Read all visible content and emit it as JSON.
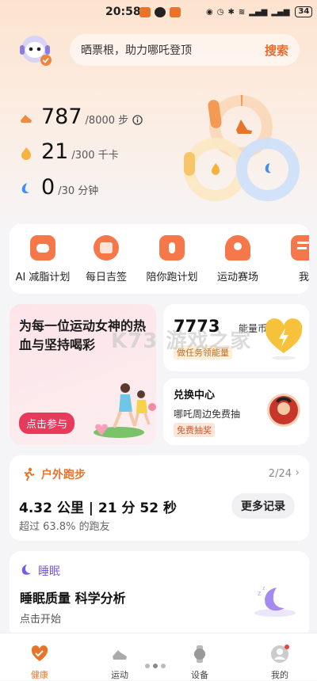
{
  "status": {
    "time": "20:58",
    "battery": "34"
  },
  "search": {
    "placeholder": "晒票根，助力哪吒登顶",
    "button": "搜索"
  },
  "metrics": [
    {
      "value": "787",
      "target": "/8000 步",
      "icon": "footprint-icon"
    },
    {
      "value": "21",
      "target": "/300 千卡",
      "icon": "flame-icon"
    },
    {
      "value": "0",
      "target": "/30 分钟",
      "icon": "clock-icon"
    }
  ],
  "quick": [
    {
      "label": "AI 减脂计划"
    },
    {
      "label": "每日吉签"
    },
    {
      "label": "陪你跑计划"
    },
    {
      "label": "运动赛场"
    },
    {
      "label": "我的指"
    }
  ],
  "promo": {
    "title": "为每一位运动女神的热血与坚持喝彩",
    "button": "点击参与"
  },
  "coins": {
    "value": "7773",
    "unit": "能量币",
    "tag": "做任务领能量"
  },
  "redeem": {
    "title": "兑换中心",
    "subtitle": "哪吒周边免费抽",
    "tag": "免费抽奖"
  },
  "run": {
    "title": "户外跑步",
    "page": "2/24",
    "detail": "4.32 公里 | 21 分 52 秒",
    "compare": "超过 63.8% 的跑友",
    "more": "更多记录"
  },
  "sleep": {
    "title": "睡眠",
    "headline": "睡眠质量 科学分析",
    "cta": "点击开始"
  },
  "tabs": [
    {
      "label": "健康",
      "icon": "heart-icon"
    },
    {
      "label": "运动",
      "icon": "shoe-icon"
    },
    {
      "label": "设备",
      "icon": "watch-icon"
    },
    {
      "label": "我的",
      "icon": "profile-icon"
    }
  ],
  "watermark": "K73 游戏之家",
  "colors": {
    "accent": "#ee6a2c",
    "ring_steps": "#f6a05f",
    "ring_calories": "#f7c56a",
    "ring_minutes": "#6aa7f2",
    "sleep": "#7b5ce0"
  }
}
